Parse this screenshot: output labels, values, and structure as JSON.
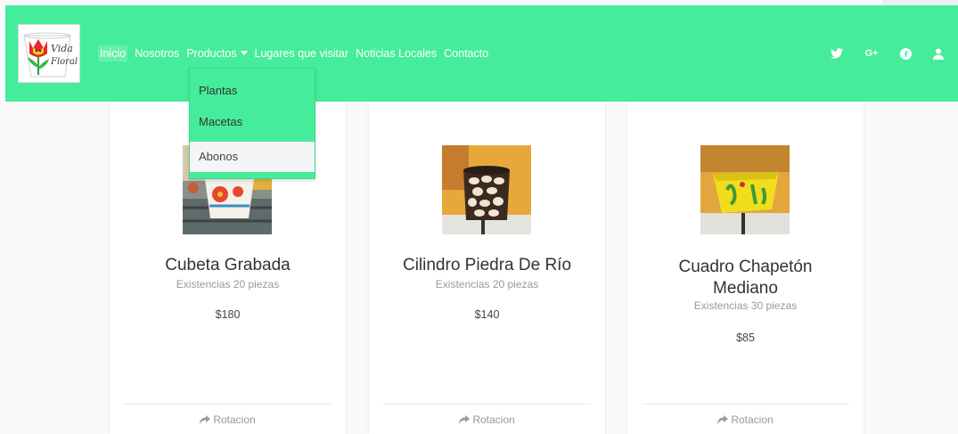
{
  "brand": {
    "logo_line1": "Vida",
    "logo_line2": "Floral"
  },
  "nav": {
    "items": [
      {
        "label": "Inicio"
      },
      {
        "label": "Nosotros"
      },
      {
        "label": "Productos"
      },
      {
        "label": "Lugares que visitar"
      },
      {
        "label": "Noticias Locales"
      },
      {
        "label": "Contacto"
      }
    ],
    "social": [
      "twitter-icon",
      "google-plus-icon",
      "facebook-icon",
      "user-icon"
    ],
    "google_plus_label": "G+"
  },
  "dropdown": {
    "items": [
      {
        "label": "Plantas"
      },
      {
        "label": "Macetas"
      },
      {
        "label": "Abonos"
      }
    ]
  },
  "products": [
    {
      "name": "Cubeta Grabada",
      "stock": "Existencias 20 piezas",
      "price": "$180",
      "action": "Rotacion"
    },
    {
      "name": "Cilindro Piedra De Río",
      "stock": "Existencias 20 piezas",
      "price": "$140",
      "action": "Rotacion"
    },
    {
      "name_line1": "Cuadro Chapetón",
      "name_line2": "Mediano",
      "stock": "Existencias 30 piezas",
      "price": "$85",
      "action": "Rotacion"
    }
  ],
  "colors": {
    "navbar": "#45ed9a",
    "dropdown_hover": "#f5f5f5",
    "card": "#ffffff"
  }
}
